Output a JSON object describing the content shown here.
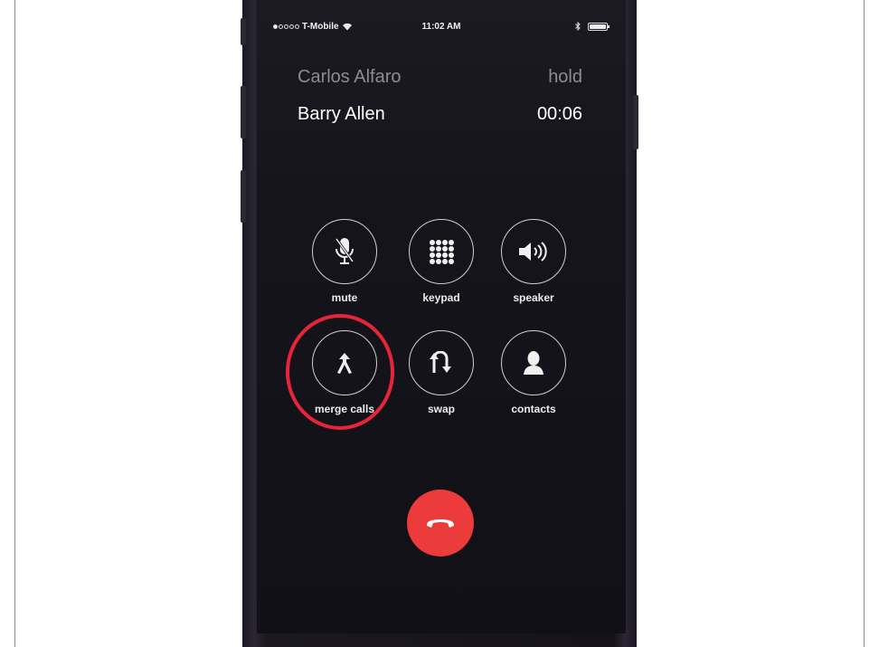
{
  "status_bar": {
    "carrier": "T-Mobile",
    "time": "11:02 AM",
    "signal_bars_filled": 1,
    "signal_bars_total": 5
  },
  "calls": {
    "held": {
      "name": "Carlos Alfaro",
      "state": "hold"
    },
    "active": {
      "name": "Barry Allen",
      "duration": "00:06"
    }
  },
  "controls": {
    "mute": "mute",
    "keypad": "keypad",
    "speaker": "speaker",
    "merge_calls": "merge calls",
    "swap": "swap",
    "contacts": "contacts"
  },
  "icons": {
    "mute": "microphone-muted-icon",
    "keypad": "keypad-grid-icon",
    "speaker": "speaker-icon",
    "merge_calls": "merge-arrow-icon",
    "swap": "swap-arrows-icon",
    "contacts": "person-icon",
    "end_call": "phone-hangup-icon"
  },
  "colors": {
    "end_call": "#ec3b3b",
    "highlight_ring": "#e8243a",
    "screen_bg": "#15141b"
  }
}
